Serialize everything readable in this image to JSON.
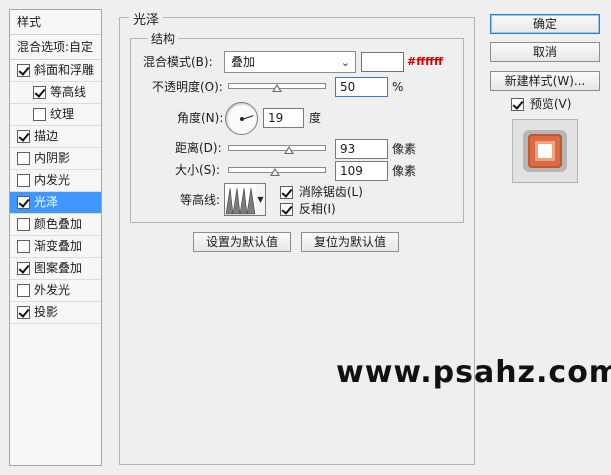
{
  "left_panel": {
    "header": "样式",
    "blend_options": "混合选项:自定",
    "items": [
      {
        "label": "斜面和浮雕",
        "checked": true,
        "level": 0,
        "selected": false
      },
      {
        "label": "等高线",
        "checked": true,
        "level": 1,
        "selected": false
      },
      {
        "label": "纹理",
        "checked": false,
        "level": 1,
        "selected": false
      },
      {
        "label": "描边",
        "checked": true,
        "level": 0,
        "selected": false
      },
      {
        "label": "内阴影",
        "checked": false,
        "level": 0,
        "selected": false
      },
      {
        "label": "内发光",
        "checked": false,
        "level": 0,
        "selected": false
      },
      {
        "label": "光泽",
        "checked": true,
        "level": 0,
        "selected": true
      },
      {
        "label": "颜色叠加",
        "checked": false,
        "level": 0,
        "selected": false
      },
      {
        "label": "渐变叠加",
        "checked": false,
        "level": 0,
        "selected": false
      },
      {
        "label": "图案叠加",
        "checked": true,
        "level": 0,
        "selected": false
      },
      {
        "label": "外发光",
        "checked": false,
        "level": 0,
        "selected": false
      },
      {
        "label": "投影",
        "checked": true,
        "level": 0,
        "selected": false
      }
    ]
  },
  "satin": {
    "group_title": "光泽",
    "structure_title": "结构",
    "blend_mode_label": "混合模式(B):",
    "blend_mode_value": "叠加",
    "blend_color_hex": "#ffffff",
    "color_annotation": "#ffffff",
    "opacity_label": "不透明度(O):",
    "opacity_value": "50",
    "opacity_unit": "%",
    "angle_label": "角度(N):",
    "angle_value": "19",
    "angle_unit": "度",
    "distance_label": "距离(D):",
    "distance_value": "93",
    "distance_unit": "像素",
    "size_label": "大小(S):",
    "size_value": "109",
    "size_unit": "像素",
    "contour_label": "等高线:",
    "anti_alias_label": "消除锯齿(L)",
    "anti_alias_checked": true,
    "invert_label": "反相(I)",
    "invert_checked": true,
    "set_default_button": "设置为默认值",
    "reset_default_button": "复位为默认值"
  },
  "sliders": {
    "opacity_fraction": 0.5,
    "distance_fraction": 0.62,
    "size_fraction": 0.48
  },
  "actions": {
    "ok_button": "确定",
    "cancel_button": "取消",
    "new_style_button": "新建样式(W)...",
    "preview_label": "预览(V)",
    "preview_checked": true
  },
  "watermark": "www.psahz.com",
  "colors": {
    "selected_row": "#3f97ff",
    "annotation_red": "#d10000",
    "preview_orange": "#d96c44"
  }
}
